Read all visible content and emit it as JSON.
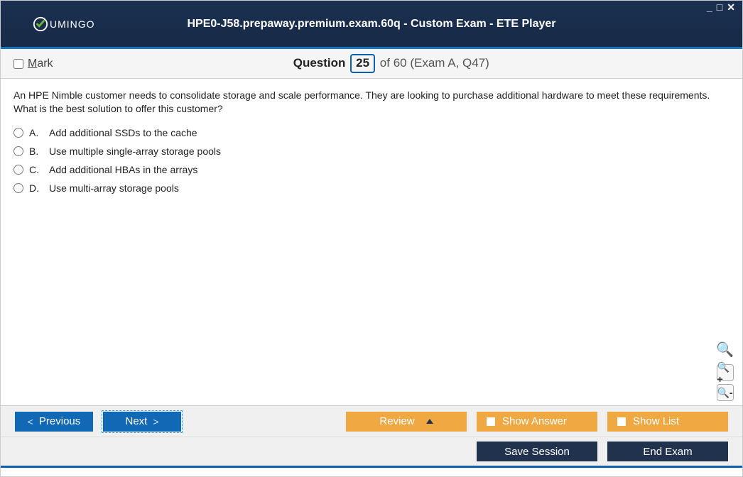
{
  "window": {
    "title": "HPE0-J58.prepaway.premium.exam.60q - Custom Exam - ETE Player",
    "logo_text": "UMINGO"
  },
  "header": {
    "mark_label_pre": "M",
    "mark_label_post": "ark",
    "question_label": "Question",
    "current_number": "25",
    "total_text": "of 60 (Exam A, Q47)"
  },
  "question": {
    "text": "An HPE Nimble customer needs to consolidate storage and scale performance. They are looking to purchase additional hardware to meet these requirements. What is the best solution to offer this customer?",
    "options": [
      {
        "letter": "A.",
        "text": "Add additional SSDs to the cache"
      },
      {
        "letter": "B.",
        "text": "Use multiple single-array storage pools"
      },
      {
        "letter": "C.",
        "text": "Add additional HBAs in the arrays"
      },
      {
        "letter": "D.",
        "text": "Use multi-array storage pools"
      }
    ]
  },
  "buttons": {
    "previous": "Previous",
    "next": "Next",
    "review": "Review",
    "show_answer": "Show Answer",
    "show_list": "Show List",
    "save_session": "Save Session",
    "end_exam": "End Exam"
  }
}
